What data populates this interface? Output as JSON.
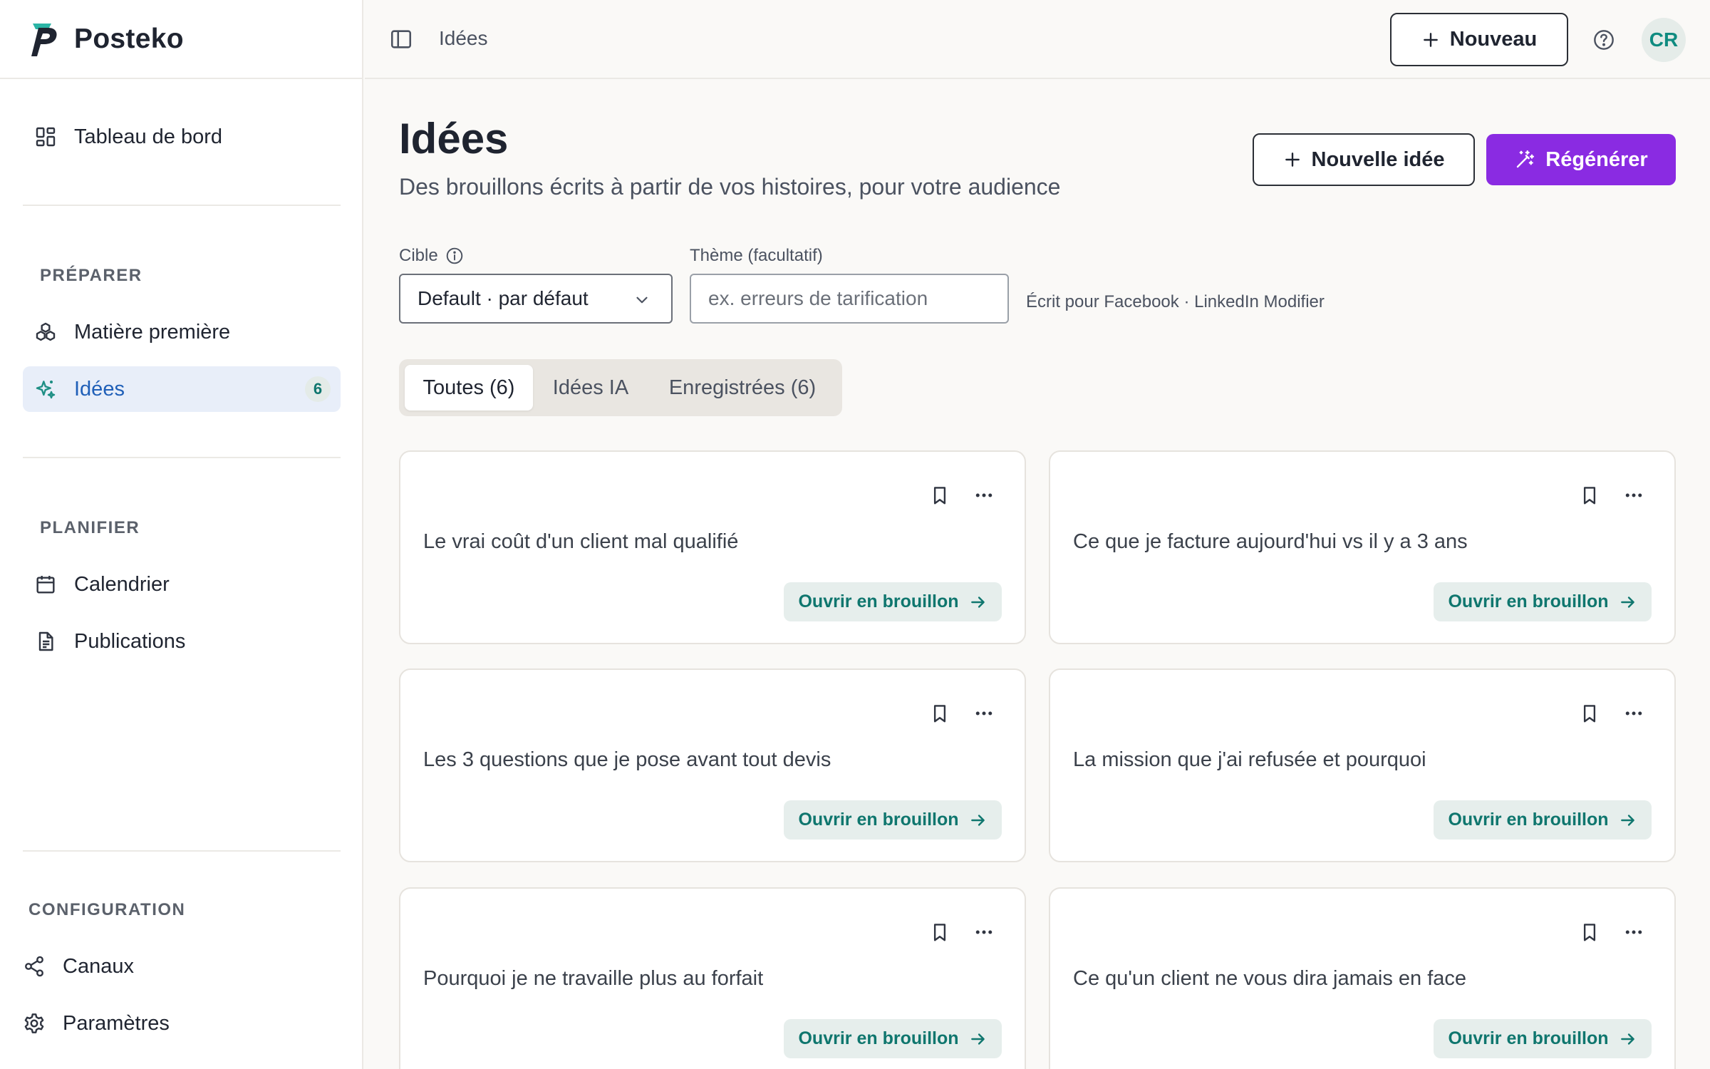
{
  "app": {
    "name": "Posteko"
  },
  "sidebar": {
    "dashboard": "Tableau de bord",
    "sections": {
      "prepare": "PRÉPARER",
      "plan": "PLANIFIER",
      "config": "CONFIGURATION"
    },
    "items": {
      "raw_material": "Matière première",
      "ideas": "Idées",
      "ideas_count": "6",
      "calendar": "Calendrier",
      "publications": "Publications",
      "channels": "Canaux",
      "settings": "Paramètres"
    }
  },
  "topbar": {
    "breadcrumb": "Idées",
    "new_label": "Nouveau",
    "avatar_initials": "CR"
  },
  "main": {
    "title": "Idées",
    "subtitle": "Des brouillons écrits à partir de vos histoires, pour votre audience",
    "new_idea_label": "Nouvelle idée",
    "regenerate_label": "Régénérer",
    "target": {
      "label": "Cible",
      "value": "Default · par défaut"
    },
    "theme": {
      "label": "Thème (facultatif)",
      "placeholder": "ex. erreurs de tarification",
      "value": ""
    },
    "written_for": "Écrit pour Facebook · LinkedIn",
    "modify_label": "Modifier",
    "tabs": [
      {
        "label": "Toutes (6)",
        "active": true
      },
      {
        "label": "Idées IA",
        "active": false
      },
      {
        "label": "Enregistrées (6)",
        "active": false
      }
    ],
    "open_draft_label": "Ouvrir en brouillon",
    "cards": [
      {
        "title": "Le vrai coût d'un client mal qualifié"
      },
      {
        "title": "Ce que je facture aujourd'hui vs il y a 3 ans"
      },
      {
        "title": "Les 3 questions que je pose avant tout devis"
      },
      {
        "title": "La mission que j'ai refusée et pourquoi"
      },
      {
        "title": "Pourquoi je ne travaille plus au forfait"
      },
      {
        "title": "Ce qu'un client ne vous dira jamais en face"
      }
    ]
  },
  "colors": {
    "accent_purple": "#8a2be2",
    "teal": "#0f766e",
    "active_nav_bg": "#e8eef9",
    "active_nav_text": "#1f5fb8"
  }
}
